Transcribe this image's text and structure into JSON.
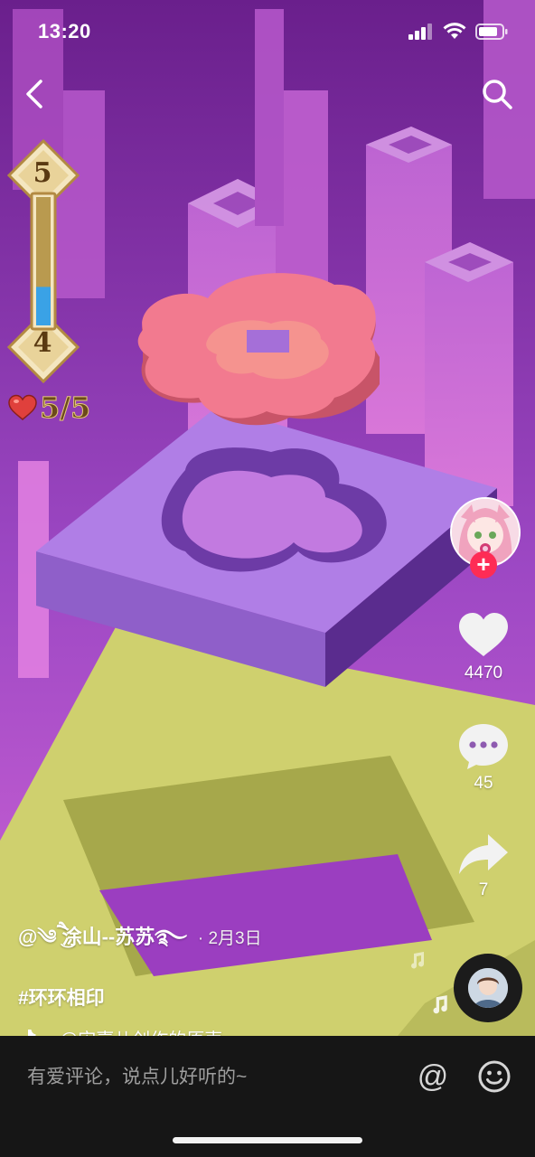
{
  "status_bar": {
    "time": "13:20",
    "icons": [
      "signal-icon",
      "wifi-icon",
      "battery-icon"
    ]
  },
  "nav": {
    "back_icon": "chevron-left-icon",
    "search_icon": "search-icon"
  },
  "game_hud": {
    "level_current": "5",
    "level_next": "4",
    "level_progress": 0.3,
    "lives": "5/5",
    "lives_icon": "heart-icon"
  },
  "actions": {
    "like_count": "4470",
    "comment_count": "45",
    "share_count": "7",
    "follow_symbol": "+"
  },
  "video": {
    "author": "@༄ཻ ͜涂山--苏苏࿐",
    "date_separator": "·",
    "date": "2月3日",
    "hashtag": "#环环相印",
    "music_title": "@宋嘉儿创作的原声"
  },
  "comment_bar": {
    "placeholder": "有爱评论，说点儿好听的~",
    "mention_symbol": "@",
    "emoji_icon": "smiley-icon"
  },
  "colors": {
    "accent_red": "#fe2c55",
    "sky_purple": "#7a2f9e",
    "slab_lavender": "#b07ee6",
    "flower_pink": "#f27a8f",
    "floor_yellow": "#cfd06e",
    "comment_bar_bg": "#161616"
  }
}
